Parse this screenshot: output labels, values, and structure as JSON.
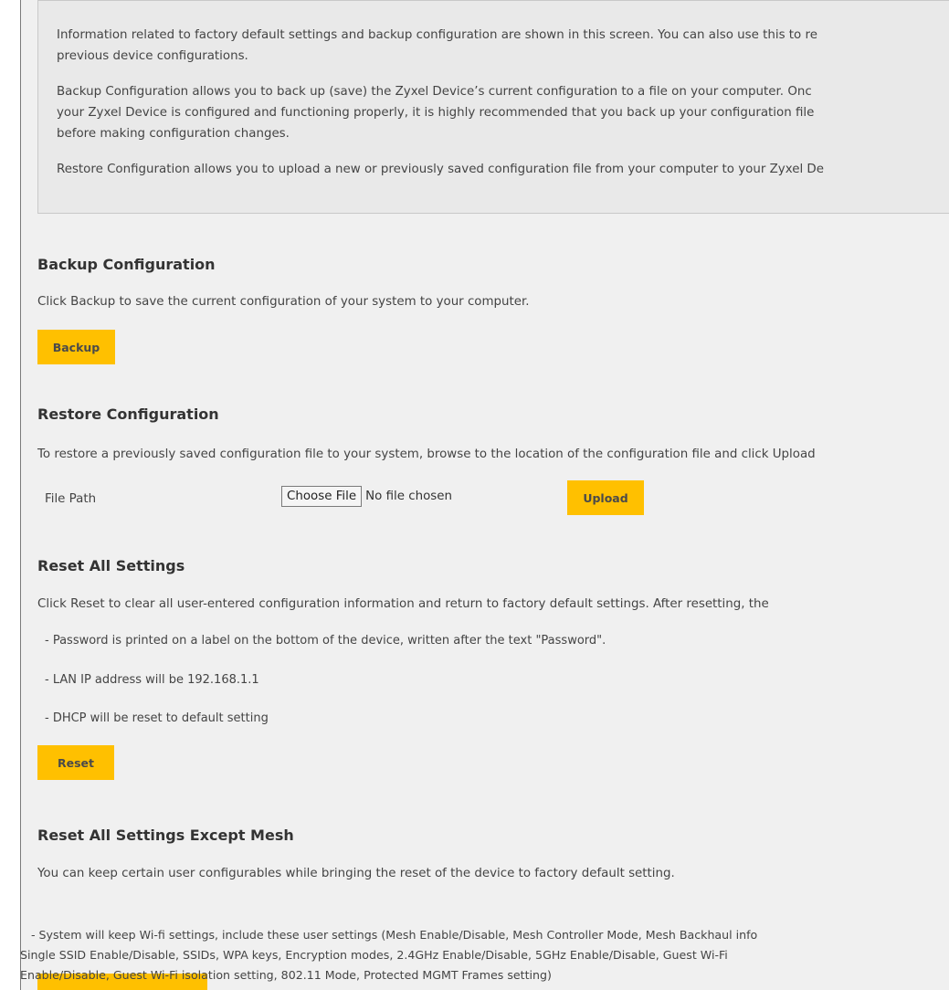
{
  "info": {
    "para1_line1": "Information related to factory default settings and backup configuration are shown in this screen. You can also use this to re",
    "para1_line2": "previous device configurations.",
    "para2_line1": "Backup Configuration allows you to back up (save) the Zyxel Device’s current configuration to a file on your computer. Onc",
    "para2_line2": "your Zyxel Device is configured and functioning properly, it is highly recommended that you back up your configuration file",
    "para2_line3": "before making configuration changes.",
    "para3_line1": "Restore Configuration allows you to upload a new or previously saved configuration file from your computer to your Zyxel De"
  },
  "backup": {
    "title": "Backup Configuration",
    "desc": "Click Backup to save the current configuration of your system to your computer.",
    "button": "Backup"
  },
  "restore": {
    "title": "Restore Configuration",
    "desc": "To restore a previously saved configuration file to your system, browse to the location of the configuration file and click Upload",
    "file_path_label": "File Path",
    "choose_file": "Choose File",
    "no_file": "No file chosen",
    "button": "Upload"
  },
  "reset": {
    "title": "Reset All Settings",
    "desc": "Click Reset to clear all user-entered configuration information and return to factory default settings. After resetting, the",
    "bullet1": "- Password is printed on a label on the bottom of the device, written after the text \"Password\".",
    "bullet2": "- LAN IP address will be 192.168.1.1",
    "bullet3": "- DHCP will be reset to default setting",
    "button": "Reset"
  },
  "reset_mesh": {
    "title": "Reset All Settings Except Mesh",
    "desc": "You can keep certain user configurables while bringing the reset of the device to factory default setting.",
    "detail_line1": "   - System will keep Wi-fi settings, include these user settings (Mesh Enable/Disable, Mesh Controller Mode, Mesh Backhaul info",
    "detail_line2": "Single SSID Enable/Disable, SSIDs, WPA keys, Encryption modes, 2.4GHz Enable/Disable, 5GHz Enable/Disable, Guest Wi-Fi",
    "detail_line3": "Enable/Disable, Guest Wi-Fi isolation setting, 802.11 Mode, Protected MGMT Frames setting)"
  },
  "colors": {
    "button_bg": "#ffc000",
    "page_bg": "#f0f0f0",
    "info_bg": "#e9e9e9"
  }
}
